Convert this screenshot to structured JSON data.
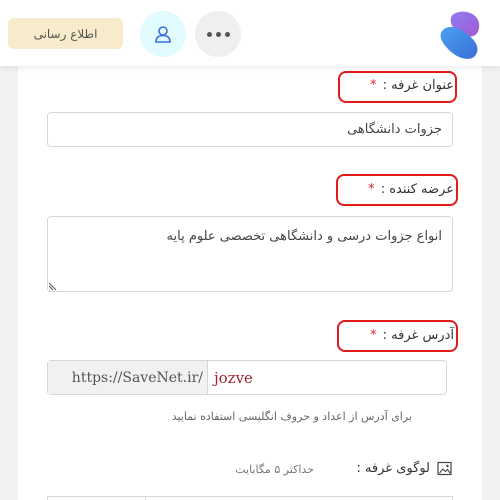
{
  "header": {
    "notify_label": "اطلاع رسانی",
    "user_icon": "user-icon",
    "more_icon": "more-dots-icon",
    "logo_icon": "brand-logo",
    "logo_colors": [
      "#4a86e8",
      "#7b68ee",
      "#9b59d6"
    ]
  },
  "form": {
    "title": {
      "label": "عنوان غرفه :",
      "required_mark": "*",
      "value": "جزوات دانشگاهی"
    },
    "provider": {
      "label": "عرضه کننده :",
      "required_mark": "*",
      "value": "انواع جزوات درسی  و دانشگاهی تخصصی علوم پایه"
    },
    "address": {
      "label": "آدرس غرفه :",
      "required_mark": "*",
      "prefix": "https://SaveNet.ir/",
      "value": "jozve",
      "hint": "برای آدرس از اعداد و حروف انگلیسی استفاده نمایید"
    },
    "logo": {
      "label": "لوگوی غرفه :",
      "note": "حداکثر ۵ مگابایت",
      "icon": "image-icon"
    }
  },
  "colors": {
    "required": "#e0242a",
    "highlight": "#e31a1a",
    "address_value": "#a0232f",
    "notify_bg": "#f8ebcc",
    "user_bg": "#e2fbff"
  }
}
